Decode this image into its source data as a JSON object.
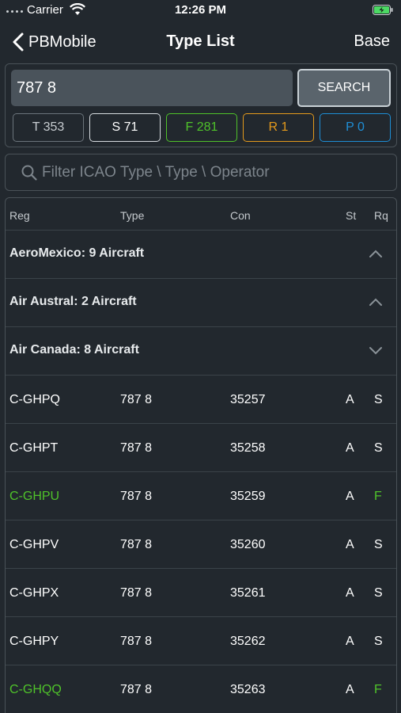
{
  "status_bar": {
    "carrier": "Carrier",
    "time": "12:26 PM"
  },
  "nav": {
    "back_label": "PBMobile",
    "title": "Type List",
    "right_label": "Base"
  },
  "search": {
    "value": "787 8",
    "button_label": "SEARCH"
  },
  "counters": [
    {
      "label": "T 353",
      "color": "#c8cdd1",
      "border": "#6b747b"
    },
    {
      "label": "S 71",
      "color": "#ffffff",
      "border": "#d6dbdf"
    },
    {
      "label": "F 281",
      "color": "#4fc22a",
      "border": "#4fc22a"
    },
    {
      "label": "R 1",
      "color": "#e49a1c",
      "border": "#e49a1c"
    },
    {
      "label": "P 0",
      "color": "#1e8ed6",
      "border": "#1e8ed6"
    }
  ],
  "filter": {
    "placeholder": "Filter ICAO Type \\ Type \\ Operator"
  },
  "table": {
    "headers": {
      "reg": "Reg",
      "type": "Type",
      "con": "Con",
      "st": "St",
      "rq": "Rq"
    },
    "groups": [
      {
        "title": "AeroMexico: 9 Aircraft",
        "chevron": "chevron-up-icon"
      },
      {
        "title": "Air Austral: 2 Aircraft",
        "chevron": "chevron-up-icon"
      },
      {
        "title": "Air Canada: 8 Aircraft",
        "chevron": "chevron-down-icon"
      }
    ],
    "rows": [
      {
        "reg": "C-GHPQ",
        "type": "787 8",
        "con": "35257",
        "st": "A",
        "rq": "S",
        "highlight": false
      },
      {
        "reg": "C-GHPT",
        "type": "787 8",
        "con": "35258",
        "st": "A",
        "rq": "S",
        "highlight": false
      },
      {
        "reg": "C-GHPU",
        "type": "787 8",
        "con": "35259",
        "st": "A",
        "rq": "F",
        "highlight": true
      },
      {
        "reg": "C-GHPV",
        "type": "787 8",
        "con": "35260",
        "st": "A",
        "rq": "S",
        "highlight": false
      },
      {
        "reg": "C-GHPX",
        "type": "787 8",
        "con": "35261",
        "st": "A",
        "rq": "S",
        "highlight": false
      },
      {
        "reg": "C-GHPY",
        "type": "787 8",
        "con": "35262",
        "st": "A",
        "rq": "S",
        "highlight": false
      },
      {
        "reg": "C-GHQQ",
        "type": "787 8",
        "con": "35263",
        "st": "A",
        "rq": "F",
        "highlight": true
      }
    ]
  },
  "colors": {
    "background": "#22282e",
    "highlight": "#4fc22a",
    "text": "#ffffff"
  }
}
